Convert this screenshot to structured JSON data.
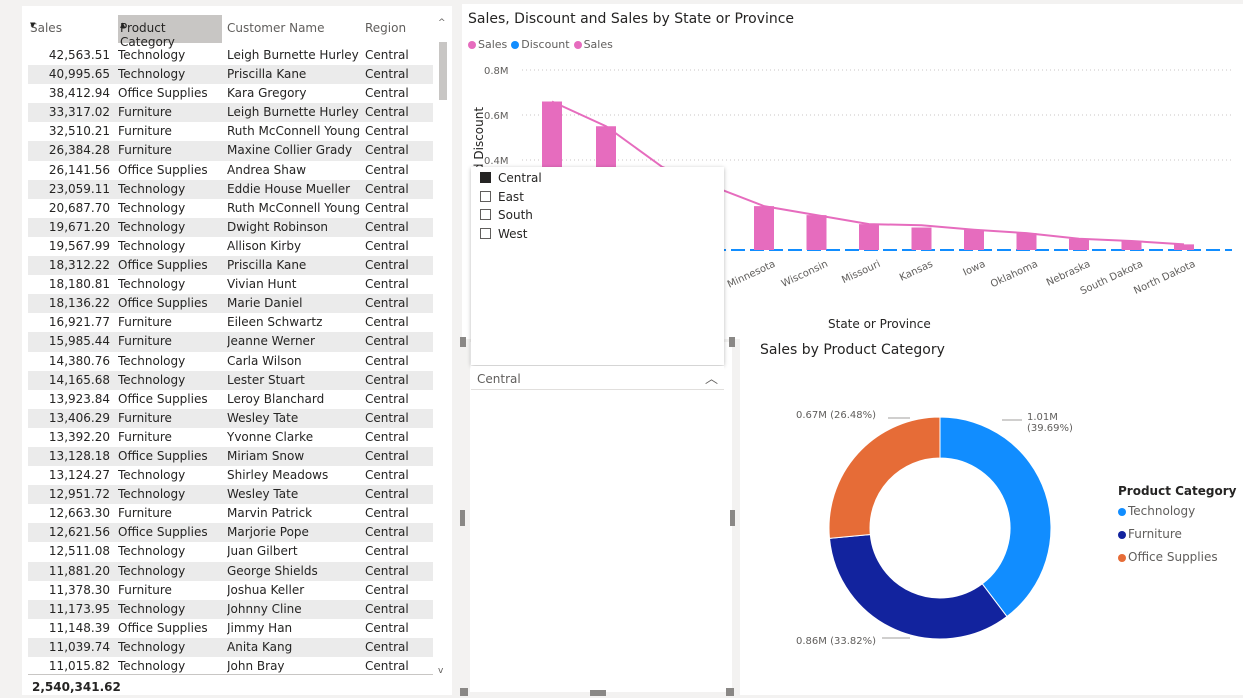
{
  "table": {
    "headers": {
      "sales": "Sales",
      "category": "Product Category",
      "customer": "Customer Name",
      "region": "Region"
    },
    "rows": [
      [
        "42,563.51",
        "Technology",
        "Leigh Burnette Hurley",
        "Central"
      ],
      [
        "40,995.65",
        "Technology",
        "Priscilla Kane",
        "Central"
      ],
      [
        "38,412.94",
        "Office Supplies",
        "Kara Gregory",
        "Central"
      ],
      [
        "33,317.02",
        "Furniture",
        "Leigh Burnette Hurley",
        "Central"
      ],
      [
        "32,510.21",
        "Furniture",
        "Ruth McConnell Young",
        "Central"
      ],
      [
        "26,384.28",
        "Furniture",
        "Maxine Collier Grady",
        "Central"
      ],
      [
        "26,141.56",
        "Office Supplies",
        "Andrea Shaw",
        "Central"
      ],
      [
        "23,059.11",
        "Technology",
        "Eddie House Mueller",
        "Central"
      ],
      [
        "20,687.70",
        "Technology",
        "Ruth McConnell Young",
        "Central"
      ],
      [
        "19,671.20",
        "Technology",
        "Dwight Robinson",
        "Central"
      ],
      [
        "19,567.99",
        "Technology",
        "Allison Kirby",
        "Central"
      ],
      [
        "18,312.22",
        "Office Supplies",
        "Priscilla Kane",
        "Central"
      ],
      [
        "18,180.81",
        "Technology",
        "Vivian Hunt",
        "Central"
      ],
      [
        "18,136.22",
        "Office Supplies",
        "Marie Daniel",
        "Central"
      ],
      [
        "16,921.77",
        "Furniture",
        "Eileen Schwartz",
        "Central"
      ],
      [
        "15,985.44",
        "Furniture",
        "Jeanne Werner",
        "Central"
      ],
      [
        "14,380.76",
        "Technology",
        "Carla Wilson",
        "Central"
      ],
      [
        "14,165.68",
        "Technology",
        "Lester Stuart",
        "Central"
      ],
      [
        "13,923.84",
        "Office Supplies",
        "Leroy Blanchard",
        "Central"
      ],
      [
        "13,406.29",
        "Furniture",
        "Wesley Tate",
        "Central"
      ],
      [
        "13,392.20",
        "Furniture",
        "Yvonne Clarke",
        "Central"
      ],
      [
        "13,128.18",
        "Office Supplies",
        "Miriam Snow",
        "Central"
      ],
      [
        "13,124.27",
        "Technology",
        "Shirley Meadows",
        "Central"
      ],
      [
        "12,951.72",
        "Technology",
        "Wesley Tate",
        "Central"
      ],
      [
        "12,663.30",
        "Furniture",
        "Marvin Patrick",
        "Central"
      ],
      [
        "12,621.56",
        "Office Supplies",
        "Marjorie Pope",
        "Central"
      ],
      [
        "12,511.08",
        "Technology",
        "Juan Gilbert",
        "Central"
      ],
      [
        "11,881.20",
        "Technology",
        "George Shields",
        "Central"
      ],
      [
        "11,378.30",
        "Furniture",
        "Joshua Keller",
        "Central"
      ],
      [
        "11,173.95",
        "Technology",
        "Johnny Cline",
        "Central"
      ],
      [
        "11,148.39",
        "Office Supplies",
        "Jimmy Han",
        "Central"
      ],
      [
        "11,039.74",
        "Technology",
        "Anita Kang",
        "Central"
      ],
      [
        "11,015.82",
        "Technology",
        "John Bray",
        "Central"
      ]
    ],
    "total": "2,540,341.62"
  },
  "combo": {
    "title": "Sales, Discount and Sales by State or Province",
    "legend": [
      {
        "label": "Sales",
        "color": "#e66cbe"
      },
      {
        "label": "Discount",
        "color": "#118dff"
      },
      {
        "label": "Sales",
        "color": "#e66cbe"
      }
    ],
    "y_axis_title": "d Discount",
    "y_ticks": [
      "0.8M",
      "0.6M",
      "0.4M"
    ],
    "x_axis_title": "State or Province",
    "x_labels": [
      "Minnesota",
      "Wisconsin",
      "Missouri",
      "Kansas",
      "Iowa",
      "Oklahoma",
      "Nebraska",
      "South Dakota",
      "North Dakota"
    ]
  },
  "chart_data": {
    "type": "bar",
    "title": "Sales, Discount and Sales by State or Province",
    "xlabel": "State or Province",
    "categories": [
      "Minnesota",
      "Wisconsin",
      "Missouri",
      "Kansas",
      "Iowa",
      "Oklahoma",
      "Nebraska",
      "South Dakota",
      "North Dakota"
    ],
    "series": [
      {
        "name": "Sales",
        "type": "bar",
        "values": [
          0.195,
          0.155,
          0.115,
          0.1,
          0.09,
          0.075,
          0.05,
          0.04,
          0.025
        ]
      },
      {
        "name": "Sales",
        "type": "line",
        "values": [
          0.195,
          0.155,
          0.115,
          0.11,
          0.09,
          0.075,
          0.05,
          0.04,
          0.025
        ]
      }
    ],
    "visible_left_bars": [
      0.66,
      0.55
    ],
    "ylim": [
      0,
      0.8
    ]
  },
  "slicer": {
    "options": [
      {
        "label": "Central",
        "checked": true
      },
      {
        "label": "East",
        "checked": false
      },
      {
        "label": "South",
        "checked": false
      },
      {
        "label": "West",
        "checked": false
      }
    ],
    "selected": "Central"
  },
  "donut": {
    "title": "Sales by Product Category",
    "legend_title": "Product Category",
    "slices": [
      {
        "label": "Technology",
        "value": 39.69,
        "display": "1.01M",
        "pct": "(39.69%)",
        "color": "#118dff"
      },
      {
        "label": "Furniture",
        "value": 33.82,
        "display": "0.86M (33.82%)",
        "color": "#12239e"
      },
      {
        "label": "Office Supplies",
        "value": 26.48,
        "display": "0.67M (26.48%)",
        "color": "#e66c37"
      }
    ]
  }
}
